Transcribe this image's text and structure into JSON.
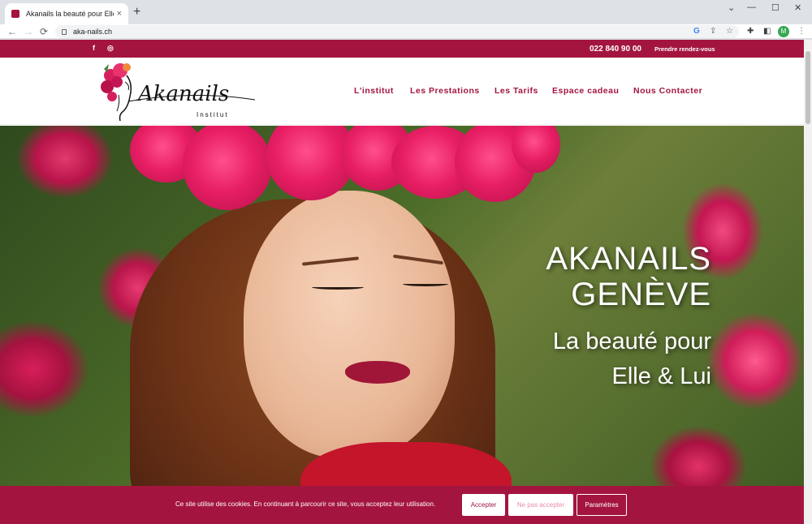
{
  "browser": {
    "tab_title": "Akanails la beauté pour Elle et Lui",
    "tab_close": "×",
    "new_tab": "+",
    "url": "aka-nails.ch",
    "back": "←",
    "forward": "→",
    "reload": "⟳",
    "profile_initial": "M",
    "min": "—",
    "max": "☐",
    "close": "✕"
  },
  "topbar": {
    "facebook": "f",
    "instagram": "◎",
    "phone": "022 840 90 00",
    "appointment": "Prendre rendez-vous"
  },
  "logo": {
    "name": "Akanails",
    "subtitle": "Institut"
  },
  "menu": [
    "L'institut",
    "Les Prestations",
    "Les Tarifs",
    "Espace cadeau",
    "Nous Contacter"
  ],
  "hero": {
    "title_line1": "AKANAILS",
    "title_line2": "GENÈVE",
    "subtitle_line1": "La beauté pour",
    "subtitle_line2": "Elle & Lui"
  },
  "cookie": {
    "text": "Ce site utilise des cookies. En continuant à parcourir ce site, vous acceptez leur utilisation.",
    "accept": "Accepter",
    "decline": "Ne pas accepter",
    "settings": "Paramètres"
  },
  "colors": {
    "brand": "#a3153f"
  }
}
